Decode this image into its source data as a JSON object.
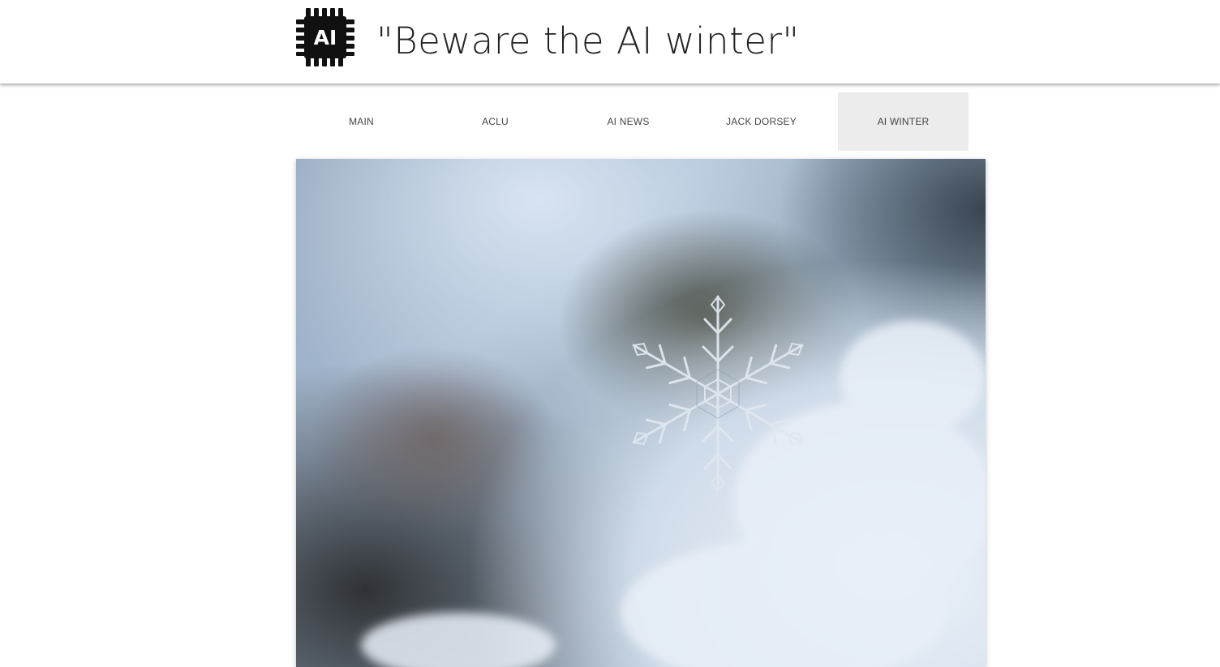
{
  "header": {
    "logo_text": "AI",
    "logo_icon": "ai-chip-icon",
    "title": "\"Beware the AI winter\""
  },
  "nav": {
    "items": [
      {
        "label": "MAIN",
        "active": false
      },
      {
        "label": "ACLU",
        "active": false
      },
      {
        "label": "AI NEWS",
        "active": false
      },
      {
        "label": "JACK DORSEY",
        "active": false
      },
      {
        "label": "AI WINTER",
        "active": true
      }
    ]
  },
  "hero": {
    "image": "snowflake-photo"
  },
  "colors": {
    "active_tab_bg": "#ececec",
    "nav_text": "#444444",
    "title_text": "#222222"
  }
}
